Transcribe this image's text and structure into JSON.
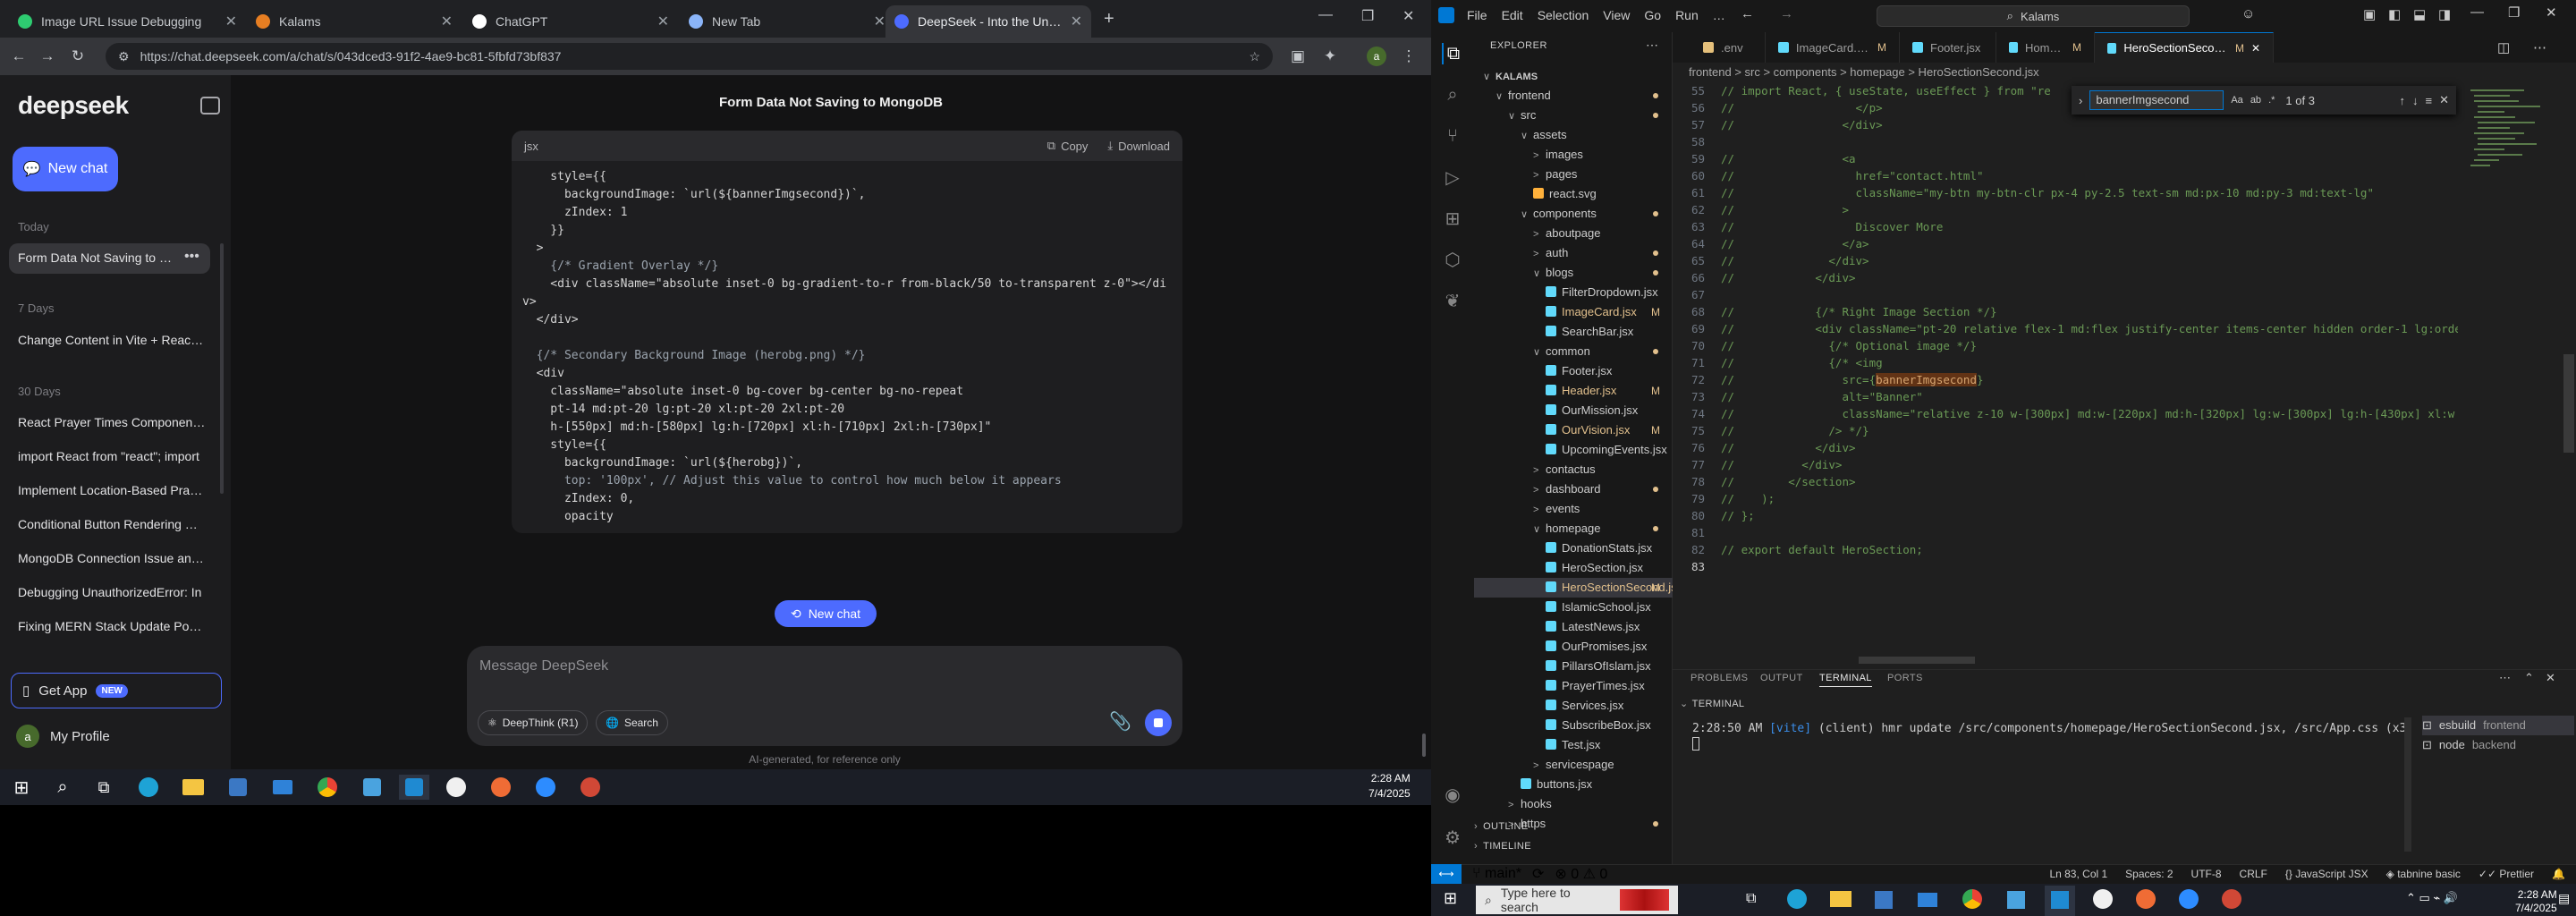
{
  "chrome": {
    "tabs": [
      {
        "title": "Image URL Issue Debugging",
        "color": "#2ecc71"
      },
      {
        "title": "Kalams",
        "color": "#e67e22"
      },
      {
        "title": "ChatGPT",
        "color": "#ffffff"
      },
      {
        "title": "New Tab",
        "color": "#8ab4f8"
      },
      {
        "title": "DeepSeek - Into the Unknown",
        "color": "#4d6bfe"
      }
    ],
    "url": "https://chat.deepseek.com/a/chat/s/043dced3-91f2-4ae9-bc81-5fbfd73bf837"
  },
  "deepseek": {
    "logo": "deepseek",
    "new_chat": "New chat",
    "sections": [
      {
        "label": "Today",
        "items": [
          "Form Data Not Saving to MongoDB"
        ]
      },
      {
        "label": "7 Days",
        "items": [
          "Change Content in Vite + React App"
        ]
      },
      {
        "label": "30 Days",
        "items": [
          "React Prayer Times Component Fix",
          "import React from \"react\"; import",
          "Implement Location-Based Prayer Times",
          "Conditional Button Rendering with",
          "MongoDB Connection Issue and Fix",
          "Debugging UnauthorizedError: In",
          "Fixing MERN Stack Update Post Issue"
        ]
      }
    ],
    "get_app": "Get App",
    "new_badge": "NEW",
    "profile_initial": "a",
    "profile": "My Profile",
    "chat_title": "Form Data Not Saving to MongoDB",
    "code_lang": "jsx",
    "copy": "Copy",
    "download": "Download",
    "code_lines": [
      "    style={{",
      "      backgroundImage: `url(${bannerImgsecond})`,",
      "      zIndex: 1",
      "    }}",
      "  >",
      "    {/* Gradient Overlay */}",
      "    <div className=\"absolute inset-0 bg-gradient-to-r from-black/50 to-transparent z-0\"></di",
      "v>",
      "  </div>",
      "",
      "  {/* Secondary Background Image (herobg.png) */}",
      "  <div",
      "    className=\"absolute inset-0 bg-cover bg-center bg-no-repeat",
      "    pt-14 md:pt-20 lg:pt-20 xl:pt-20 2xl:pt-20",
      "    h-[550px] md:h-[580px] lg:h-[720px] xl:h-[710px] 2xl:h-[730px]\"",
      "    style={{",
      "      backgroundImage: `url(${herobg})`,",
      "      top: '100px', // Adjust this value to control how much below it appears",
      "      zIndex: 0,",
      "      opacity"
    ],
    "new_chat_float": "New chat",
    "placeholder": "Message DeepSeek",
    "deepthink": "DeepThink (R1)",
    "search": "Search",
    "disclaimer": "AI-generated, for reference only"
  },
  "taskbar_left": {
    "time": "2:28 AM",
    "date": "7/4/2025"
  },
  "vscode": {
    "menu": [
      "File",
      "Edit",
      "Selection",
      "View",
      "Go",
      "Run",
      "…"
    ],
    "search": "Kalams",
    "explorer_title": "EXPLORER",
    "tree": [
      {
        "label": "KALAMS",
        "indent": 0,
        "type": "root",
        "chev": "∨"
      },
      {
        "label": "frontend",
        "indent": 1,
        "type": "folder",
        "chev": "∨",
        "dot": "#e2c08d"
      },
      {
        "label": "src",
        "indent": 2,
        "type": "folder",
        "chev": "∨",
        "dot": "#e2c08d"
      },
      {
        "label": "assets",
        "indent": 3,
        "type": "folder",
        "chev": "∨"
      },
      {
        "label": "images",
        "indent": 4,
        "type": "folder",
        "chev": ">"
      },
      {
        "label": "pages",
        "indent": 4,
        "type": "folder",
        "chev": ">"
      },
      {
        "label": "react.svg",
        "indent": 4,
        "type": "svg"
      },
      {
        "label": "components",
        "indent": 3,
        "type": "folder",
        "chev": "∨",
        "dot": "#e2c08d"
      },
      {
        "label": "aboutpage",
        "indent": 4,
        "type": "folder",
        "chev": ">"
      },
      {
        "label": "auth",
        "indent": 4,
        "type": "folder",
        "chev": ">",
        "dot": "#e2c08d"
      },
      {
        "label": "blogs",
        "indent": 4,
        "type": "folder",
        "chev": "∨",
        "dot": "#e2c08d"
      },
      {
        "label": "FilterDropdown.jsx",
        "indent": 5,
        "type": "jsx"
      },
      {
        "label": "ImageCard.jsx",
        "indent": 5,
        "type": "jsx",
        "mod": "M"
      },
      {
        "label": "SearchBar.jsx",
        "indent": 5,
        "type": "jsx"
      },
      {
        "label": "common",
        "indent": 4,
        "type": "folder",
        "chev": "∨",
        "dot": "#e2c08d"
      },
      {
        "label": "Footer.jsx",
        "indent": 5,
        "type": "jsx"
      },
      {
        "label": "Header.jsx",
        "indent": 5,
        "type": "jsx",
        "mod": "M"
      },
      {
        "label": "OurMission.jsx",
        "indent": 5,
        "type": "jsx"
      },
      {
        "label": "OurVision.jsx",
        "indent": 5,
        "type": "jsx",
        "mod": "M"
      },
      {
        "label": "UpcomingEvents.jsx",
        "indent": 5,
        "type": "jsx"
      },
      {
        "label": "contactus",
        "indent": 4,
        "type": "folder",
        "chev": ">"
      },
      {
        "label": "dashboard",
        "indent": 4,
        "type": "folder",
        "chev": ">",
        "dot": "#e2c08d"
      },
      {
        "label": "events",
        "indent": 4,
        "type": "folder",
        "chev": ">"
      },
      {
        "label": "homepage",
        "indent": 4,
        "type": "folder",
        "chev": "∨",
        "dot": "#e2c08d"
      },
      {
        "label": "DonationStats.jsx",
        "indent": 5,
        "type": "jsx"
      },
      {
        "label": "HeroSection.jsx",
        "indent": 5,
        "type": "jsx"
      },
      {
        "label": "HeroSectionSecond.jsx",
        "indent": 5,
        "type": "jsx",
        "mod": "M",
        "selected": true
      },
      {
        "label": "IslamicSchool.jsx",
        "indent": 5,
        "type": "jsx"
      },
      {
        "label": "LatestNews.jsx",
        "indent": 5,
        "type": "jsx"
      },
      {
        "label": "OurPromises.jsx",
        "indent": 5,
        "type": "jsx"
      },
      {
        "label": "PillarsOfIslam.jsx",
        "indent": 5,
        "type": "jsx"
      },
      {
        "label": "PrayerTimes.jsx",
        "indent": 5,
        "type": "jsx"
      },
      {
        "label": "Services.jsx",
        "indent": 5,
        "type": "jsx"
      },
      {
        "label": "SubscribeBox.jsx",
        "indent": 5,
        "type": "jsx"
      },
      {
        "label": "Test.jsx",
        "indent": 5,
        "type": "jsx"
      },
      {
        "label": "servicespage",
        "indent": 4,
        "type": "folder",
        "chev": ">"
      },
      {
        "label": "buttons.jsx",
        "indent": 3,
        "type": "jsx"
      },
      {
        "label": "hooks",
        "indent": 2,
        "type": "folder",
        "chev": ">"
      },
      {
        "label": "https",
        "indent": 2,
        "type": "folder",
        "chev": ">",
        "dot": "#e2c08d"
      }
    ],
    "editor_tabs": [
      {
        "label": ".env",
        "mod": "",
        "color": "#e5c07b"
      },
      {
        "label": "ImageCard.jsx",
        "mod": "M",
        "color": "#61dafb"
      },
      {
        "label": "Footer.jsx",
        "mod": "",
        "color": "#61dafb"
      },
      {
        "label": "Home.jsx",
        "mod": "M",
        "color": "#61dafb"
      },
      {
        "label": "HeroSectionSecond.jsx",
        "mod": "M",
        "color": "#61dafb",
        "active": true
      }
    ],
    "breadcrumb": "frontend  >  src  >  components  >  homepage  >  HeroSectionSecond.jsx",
    "find": {
      "query": "bannerImgsecond",
      "count": "1 of 3"
    },
    "code": [
      {
        "n": "56",
        "t": "//                  </p>"
      },
      {
        "n": "57",
        "t": "//                </div>"
      },
      {
        "n": "58",
        "t": ""
      },
      {
        "n": "59",
        "t": "//                <a"
      },
      {
        "n": "60",
        "t": "//                  href=\"contact.html\""
      },
      {
        "n": "61",
        "t": "//                  className=\"my-btn my-btn-clr px-4 py-2.5 text-sm md:px-10 md:py-3 md:text-lg\""
      },
      {
        "n": "62",
        "t": "//                >"
      },
      {
        "n": "63",
        "t": "//                  Discover More"
      },
      {
        "n": "64",
        "t": "//                </a>"
      },
      {
        "n": "65",
        "t": "//              </div>"
      },
      {
        "n": "66",
        "t": "//            </div>"
      },
      {
        "n": "67",
        "t": ""
      },
      {
        "n": "68",
        "t": "//            {/* Right Image Section */}"
      },
      {
        "n": "69",
        "t": "//            <div className=\"pt-20 relative flex-1 md:flex justify-center items-center hidden order-1 lg:orde"
      },
      {
        "n": "70",
        "t": "//              {/* Optional image */}"
      },
      {
        "n": "71",
        "t": "//              {/* <img"
      },
      {
        "n": "72",
        "t": "//                src={bannerImgsecond}",
        "hl": "bannerImgsecond"
      },
      {
        "n": "73",
        "t": "//                alt=\"Banner\""
      },
      {
        "n": "74",
        "t": "//                className=\"relative z-10 w-[300px] md:w-[220px] md:h-[320px] lg:w-[300px] lg:h-[430px] xl:w"
      },
      {
        "n": "75",
        "t": "//              /> */}"
      },
      {
        "n": "76",
        "t": "//            </div>"
      },
      {
        "n": "77",
        "t": "//          </div>"
      },
      {
        "n": "78",
        "t": "//        </section>"
      },
      {
        "n": "79",
        "t": "//    );"
      },
      {
        "n": "80",
        "t": "// };"
      },
      {
        "n": "81",
        "t": ""
      },
      {
        "n": "82",
        "t": "// export default HeroSection;"
      },
      {
        "n": "83",
        "t": ""
      }
    ],
    "first_line": {
      "n": "55",
      "t": "// import React, { useState, useEffect } from \"re"
    },
    "panel_tabs": [
      "PROBLEMS",
      "OUTPUT",
      "TERMINAL",
      "PORTS"
    ],
    "terminal_title": "TERMINAL",
    "terminal_time": "2:28:50 AM",
    "terminal_tag": "[vite]",
    "terminal_text": " (client) hmr update /src/components/homepage/HeroSectionSecond.jsx, /src/App.css (x3)",
    "terminals": [
      {
        "name": "esbuild",
        "dir": "frontend"
      },
      {
        "name": "node",
        "dir": "backend"
      }
    ],
    "outline": "OUTLINE",
    "timeline": "TIMELINE",
    "status": {
      "branch": "main*",
      "errors": "0",
      "warnings": "0",
      "position": "Ln 83, Col 1",
      "spaces": "Spaces: 2",
      "encoding": "UTF-8",
      "eol": "CRLF",
      "language": "JavaScript JSX",
      "tabnine": "tabnine basic",
      "prettier": "Prettier"
    }
  },
  "taskbar_right": {
    "search": "Type here to search",
    "time": "2:28 AM",
    "date": "7/4/2025"
  }
}
